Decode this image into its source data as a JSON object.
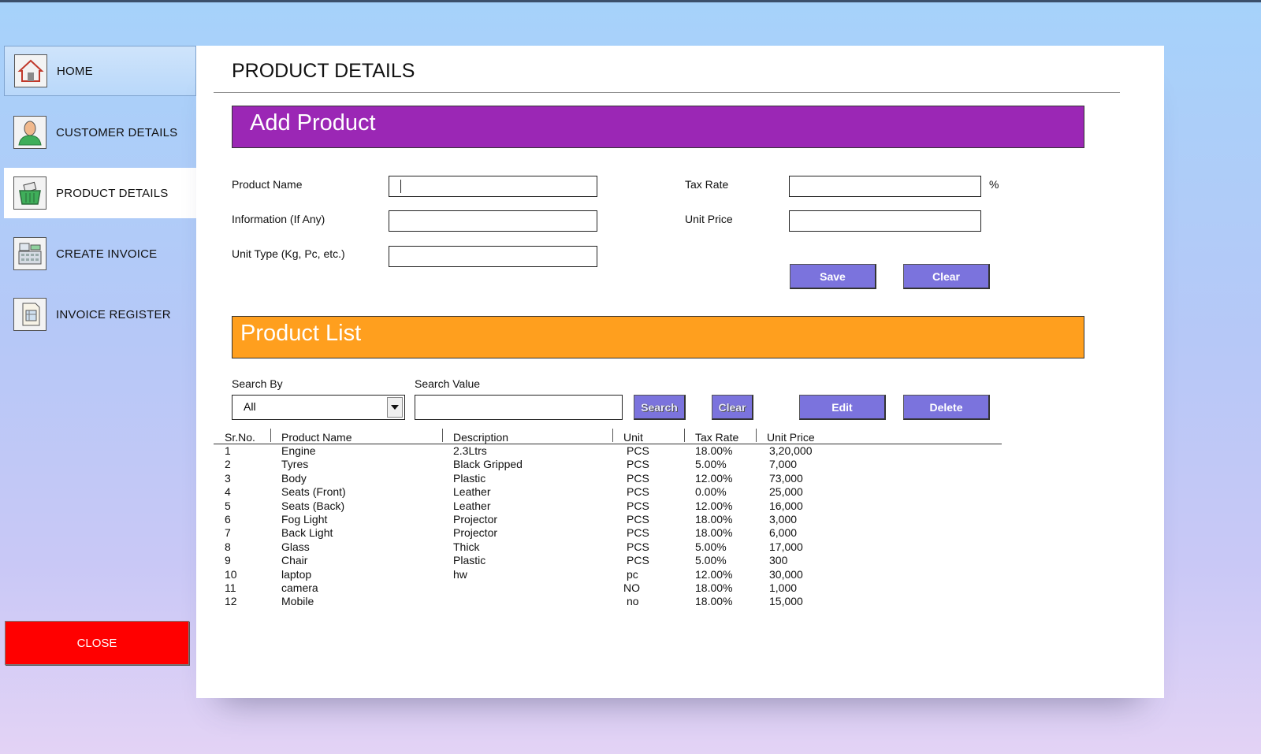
{
  "sidebar": {
    "items": [
      {
        "label": "HOME",
        "icon": "house-icon"
      },
      {
        "label": "CUSTOMER DETAILS",
        "icon": "person-icon"
      },
      {
        "label": "PRODUCT DETAILS",
        "icon": "basket-icon"
      },
      {
        "label": "CREATE INVOICE",
        "icon": "cash-register-icon"
      },
      {
        "label": "INVOICE REGISTER",
        "icon": "register-book-icon"
      }
    ],
    "close_label": "CLOSE"
  },
  "page": {
    "title": "PRODUCT DETAILS"
  },
  "add_product": {
    "banner": "Add Product",
    "product_name_label": "Product Name",
    "information_label": "Information (If Any)",
    "unit_type_label": "Unit Type (Kg, Pc, etc.)",
    "tax_rate_label": "Tax Rate",
    "tax_rate_unit": "%",
    "unit_price_label": "Unit Price",
    "product_name_value": "",
    "information_value": "",
    "unit_type_value": "",
    "tax_rate_value": "",
    "unit_price_value": "",
    "save_label": "Save",
    "clear_label": "Clear"
  },
  "product_list": {
    "banner": "Product List",
    "search_by_label": "Search By",
    "search_by_value": "All",
    "search_value_label": "Search Value",
    "search_value": "",
    "search_label": "Search",
    "clear_label": "Clear",
    "edit_label": "Edit",
    "delete_label": "Delete",
    "columns": [
      "Sr.No.",
      "Product Name",
      "Description",
      "Unit",
      "Tax Rate",
      "Unit Price"
    ],
    "rows": [
      [
        "1",
        "Engine",
        "2.3Ltrs",
        "PCS",
        "18.00%",
        "3,20,000"
      ],
      [
        "2",
        "Tyres",
        "Black Gripped",
        "PCS",
        "5.00%",
        "7,000"
      ],
      [
        "3",
        "Body",
        "Plastic",
        "PCS",
        "12.00%",
        "73,000"
      ],
      [
        "4",
        "Seats (Front)",
        "Leather",
        "PCS",
        "0.00%",
        "25,000"
      ],
      [
        "5",
        "Seats (Back)",
        "Leather",
        "PCS",
        "12.00%",
        "16,000"
      ],
      [
        "6",
        "Fog Light",
        "Projector",
        "PCS",
        "18.00%",
        "3,000"
      ],
      [
        "7",
        "Back Light",
        "Projector",
        "PCS",
        "18.00%",
        "6,000"
      ],
      [
        "8",
        "Glass",
        "Thick",
        "PCS",
        "5.00%",
        "17,000"
      ],
      [
        "9",
        "Chair",
        "Plastic",
        "PCS",
        "5.00%",
        "300"
      ],
      [
        "10",
        "laptop",
        "hw",
        "pc",
        "12.00%",
        "30,000"
      ],
      [
        "11",
        "camera",
        "",
        "NO",
        "18.00%",
        "1,000"
      ],
      [
        "12",
        "Mobile",
        "",
        "no",
        "18.00%",
        "15,000"
      ]
    ]
  },
  "colors": {
    "add_banner": "#9b27b5",
    "list_banner": "#ff9f1e",
    "button": "#7b73dd",
    "close": "#ff0000"
  }
}
